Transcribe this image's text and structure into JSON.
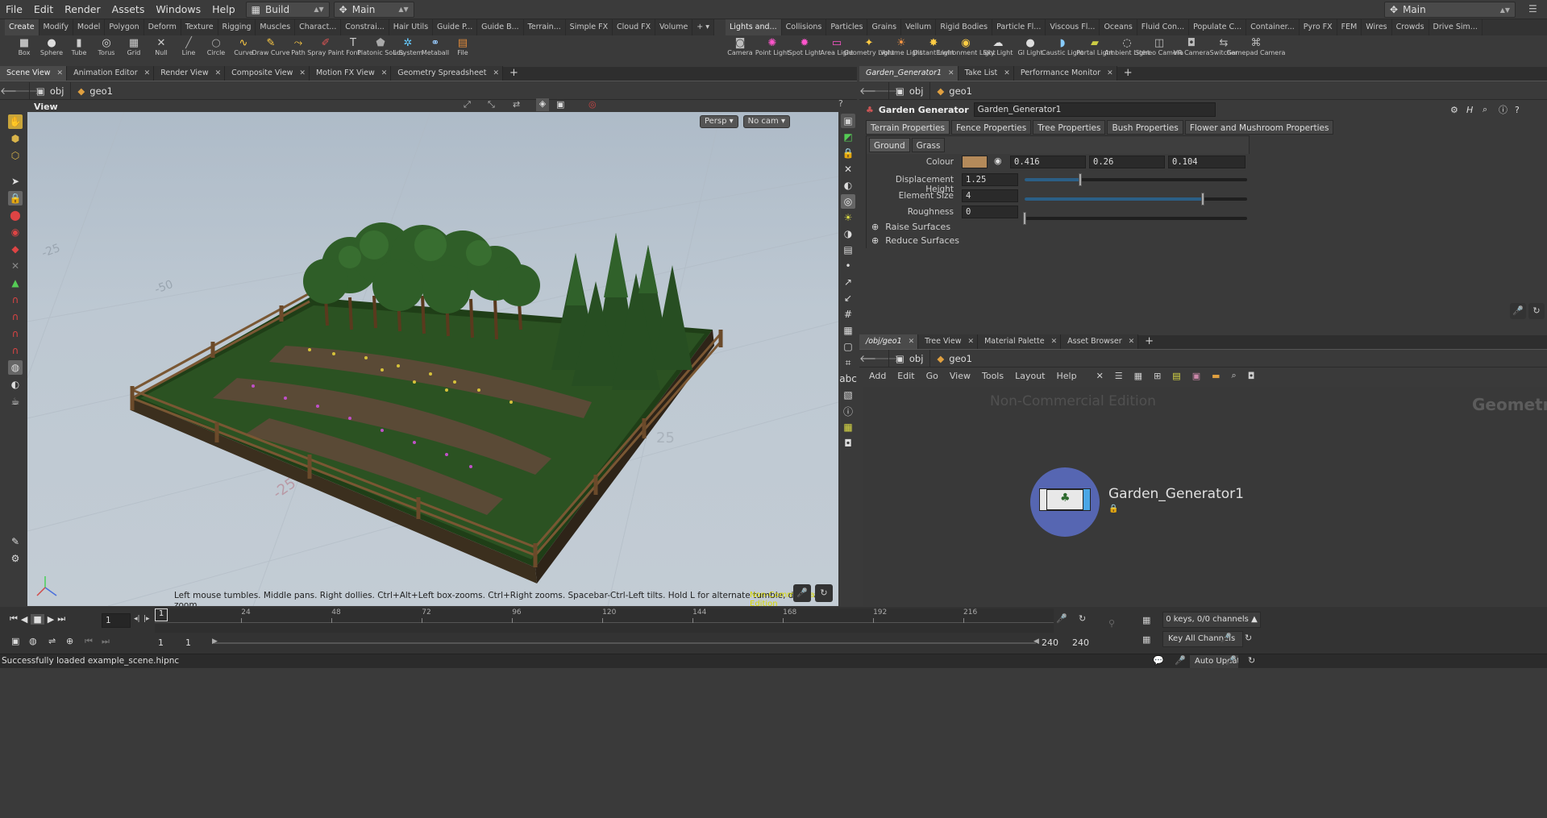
{
  "menubar": {
    "items": [
      "File",
      "Edit",
      "Render",
      "Assets",
      "Windows",
      "Help"
    ],
    "desktop": "Build",
    "context": "Main",
    "right_context": "Main"
  },
  "shelf_tabs_left": [
    "Create",
    "Modify",
    "Model",
    "Polygon",
    "Deform",
    "Texture",
    "Rigging",
    "Muscles",
    "Charact...",
    "Constrai...",
    "Hair Utils",
    "Guide P...",
    "Guide B...",
    "Terrain...",
    "Simple FX",
    "Cloud FX",
    "Volume"
  ],
  "shelf_tabs_right": [
    "Lights and...",
    "Collisions",
    "Particles",
    "Grains",
    "Vellum",
    "Rigid Bodies",
    "Particle Fl...",
    "Viscous Fl...",
    "Oceans",
    "Fluid Con...",
    "Populate C...",
    "Container...",
    "Pyro FX",
    "FEM",
    "Wires",
    "Crowds",
    "Drive Sim..."
  ],
  "tools_left": [
    {
      "label": "Box",
      "icon": "box-icon"
    },
    {
      "label": "Sphere",
      "icon": "sphere-icon"
    },
    {
      "label": "Tube",
      "icon": "tube-icon"
    },
    {
      "label": "Torus",
      "icon": "torus-icon"
    },
    {
      "label": "Grid",
      "icon": "grid-icon"
    },
    {
      "label": "Null",
      "icon": "null-icon"
    },
    {
      "label": "Line",
      "icon": "line-icon"
    },
    {
      "label": "Circle",
      "icon": "circle-icon"
    },
    {
      "label": "Curve",
      "icon": "curve-icon"
    },
    {
      "label": "Draw Curve",
      "icon": "draw-curve-icon"
    },
    {
      "label": "Path",
      "icon": "path-icon"
    },
    {
      "label": "Spray Paint",
      "icon": "spray-paint-icon"
    },
    {
      "label": "Font",
      "icon": "font-icon"
    },
    {
      "label": "Platonic Solids",
      "icon": "platonic-icon"
    },
    {
      "label": "L-System",
      "icon": "lsystem-icon"
    },
    {
      "label": "Metaball",
      "icon": "metaball-icon"
    },
    {
      "label": "File",
      "icon": "file-icon"
    }
  ],
  "tools_right": [
    {
      "label": "Camera",
      "icon": "camera-icon"
    },
    {
      "label": "Point Light",
      "icon": "point-light-icon"
    },
    {
      "label": "Spot Light",
      "icon": "spot-light-icon"
    },
    {
      "label": "Area Light",
      "icon": "area-light-icon"
    },
    {
      "label": "Geometry Light",
      "icon": "geometry-light-icon"
    },
    {
      "label": "Volume Light",
      "icon": "volume-light-icon"
    },
    {
      "label": "Distant Light",
      "icon": "distant-light-icon"
    },
    {
      "label": "Environment Light",
      "icon": "environment-light-icon"
    },
    {
      "label": "Sky Light",
      "icon": "sky-light-icon"
    },
    {
      "label": "GI Light",
      "icon": "gi-light-icon"
    },
    {
      "label": "Caustic Light",
      "icon": "caustic-light-icon"
    },
    {
      "label": "Portal Light",
      "icon": "portal-light-icon"
    },
    {
      "label": "Ambient Light",
      "icon": "ambient-light-icon"
    },
    {
      "label": "Stereo Camera",
      "icon": "stereo-camera-icon"
    },
    {
      "label": "VR Camera",
      "icon": "vr-camera-icon"
    },
    {
      "label": "Switcher",
      "icon": "switcher-icon"
    },
    {
      "label": "Gamepad Camera",
      "icon": "gamepad-camera-icon"
    }
  ],
  "left_pane": {
    "tabs": [
      "Scene View",
      "Animation Editor",
      "Render View",
      "Composite View",
      "Motion FX View",
      "Geometry Spreadsheet"
    ],
    "path": [
      "obj",
      "geo1"
    ],
    "view_label": "View",
    "persp": "Persp",
    "cam": "No cam",
    "grid_labels": [
      "-25",
      "25",
      "-50",
      "-25"
    ],
    "hint": "Left mouse tumbles. Middle pans. Right dollies. Ctrl+Alt+Left box-zooms. Ctrl+Right zooms. Spacebar-Ctrl-Left tilts. Hold L for alternate tumble, dolly, and zoom.",
    "watermark": "Non-Commercial Edition"
  },
  "param_pane": {
    "tabs": [
      "Garden_Generator1",
      "Take List",
      "Performance Monitor"
    ],
    "path": [
      "obj",
      "geo1"
    ],
    "node_type": "Garden Generator",
    "node_name": "Garden_Generator1",
    "folders": [
      "Terrain Properties",
      "Fence Properties",
      "Tree Properties",
      "Bush Properties",
      "Flower and Mushroom Properties"
    ],
    "subtabs": [
      "Ground",
      "Grass"
    ],
    "colour_label": "Colour",
    "colour_hex": "#b48a5a",
    "colour": [
      "0.416",
      "0.26",
      "0.104"
    ],
    "disp_label": "Displacement Height",
    "disp_value": "1.25",
    "disp_fraction": 0.25,
    "elem_label": "Element Size",
    "elem_value": "4",
    "elem_fraction": 0.8,
    "rough_label": "Roughness",
    "rough_value": "0",
    "rough_fraction": 0,
    "raise": "Raise Surfaces",
    "reduce": "Reduce Surfaces"
  },
  "network_pane": {
    "tabs": [
      "/obj/geo1",
      "Tree View",
      "Material Palette",
      "Asset Browser"
    ],
    "path": [
      "obj",
      "geo1"
    ],
    "menu": [
      "Add",
      "Edit",
      "Go",
      "View",
      "Tools",
      "Layout",
      "Help"
    ],
    "watermark": "Non-Commercial Edition",
    "context_label": "Geometry",
    "node_label": "Garden_Generator1"
  },
  "timeline": {
    "frame": "1",
    "marker": "1",
    "ticks": [
      "24",
      "48",
      "72",
      "96",
      "120",
      "144",
      "168",
      "192",
      "216"
    ],
    "start": "1",
    "start2": "1",
    "end": "240",
    "end2": "240",
    "keys": "0 keys, 0/0 channels",
    "key_all": "Key All Channels",
    "auto_update": "Auto Update"
  },
  "status": "Successfully loaded example_scene.hipnc",
  "colors": {
    "accent": "#4a8cc9",
    "node_ring": "#5a6cc0",
    "viewport_top": "#aebbc8",
    "viewport_bottom": "#c3ccd4",
    "grass": "#2e5a22",
    "fence": "#6b4a2a"
  }
}
